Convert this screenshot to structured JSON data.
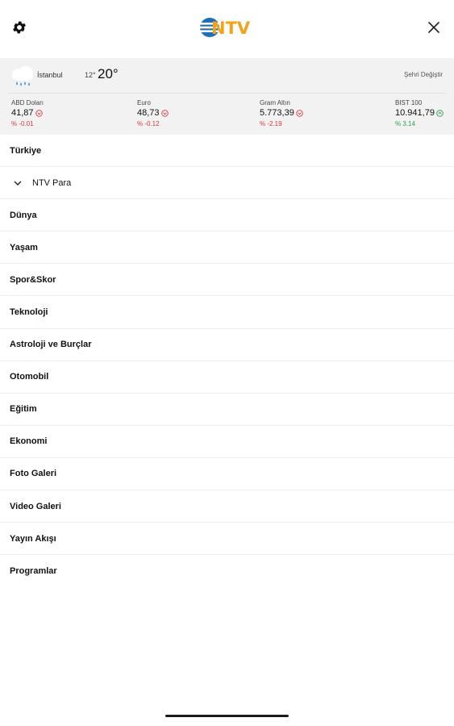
{
  "header": {
    "logo_text": "NTV"
  },
  "weather": {
    "city": "İstanbul",
    "temp_min": "12°",
    "temp_max": "20°",
    "change_city": "Şehri Değiştir"
  },
  "markets": [
    {
      "label": "ABD Doları",
      "value": "41,87",
      "change": "% -0.01",
      "direction": "down"
    },
    {
      "label": "Euro",
      "value": "48,73",
      "change": "% -0.12",
      "direction": "down"
    },
    {
      "label": "Gram Altın",
      "value": "5.773,39",
      "change": "% -2.19",
      "direction": "down"
    },
    {
      "label": "BIST 100",
      "value": "10.941,79",
      "change": "% 3.14",
      "direction": "up"
    }
  ],
  "menu": [
    {
      "label": "Türkiye"
    },
    {
      "label": "NTV Para",
      "expandable": true
    },
    {
      "label": "Dünya"
    },
    {
      "label": "Yaşam"
    },
    {
      "label": "Spor&Skor"
    },
    {
      "label": "Teknoloji"
    },
    {
      "label": "Astroloji ve Burçlar"
    },
    {
      "label": "Otomobil"
    },
    {
      "label": "Eğitim"
    },
    {
      "label": "Ekonomi"
    },
    {
      "label": "Foto Galeri"
    },
    {
      "label": "Video Galeri"
    },
    {
      "label": "Yayın Akışı"
    },
    {
      "label": "Programlar"
    }
  ],
  "colors": {
    "down": "#d23b3b",
    "up": "#2c9e4b",
    "logo_blue": "#1f6fb5",
    "logo_orange": "#f5a21b"
  }
}
